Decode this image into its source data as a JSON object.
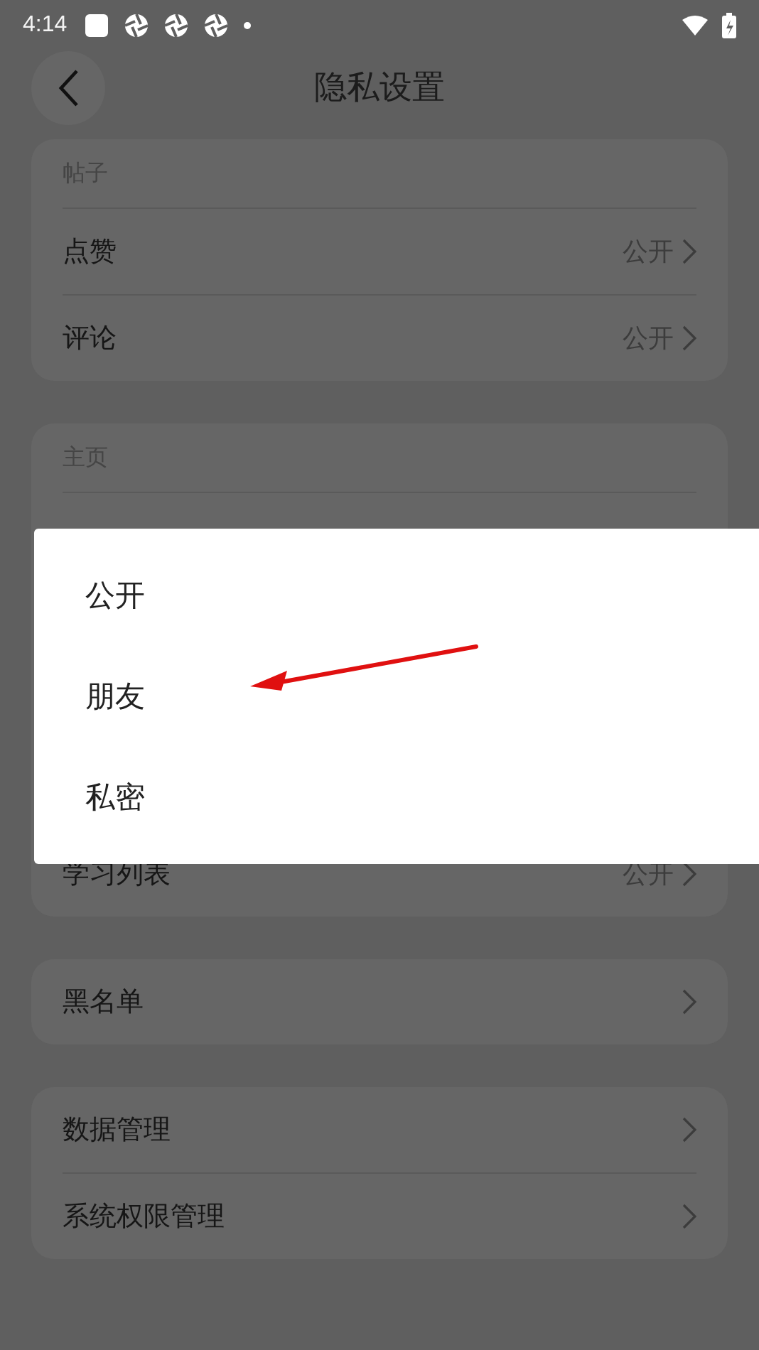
{
  "status_bar": {
    "time": "4:14"
  },
  "header": {
    "title": "隐私设置"
  },
  "sections": [
    {
      "title": "帖子",
      "rows": [
        {
          "label": "点赞",
          "value": "公开"
        },
        {
          "label": "评论",
          "value": "公开"
        }
      ]
    },
    {
      "title": "主页",
      "menu": {
        "options": [
          {
            "label": "公开"
          },
          {
            "label": "朋友"
          },
          {
            "label": "私密"
          }
        ]
      },
      "rows": [
        {
          "label": "学习列表",
          "value": "公开"
        }
      ]
    },
    {
      "rows": [
        {
          "label": "黑名单"
        }
      ]
    },
    {
      "rows": [
        {
          "label": "数据管理"
        },
        {
          "label": "系统权限管理"
        }
      ]
    }
  ]
}
